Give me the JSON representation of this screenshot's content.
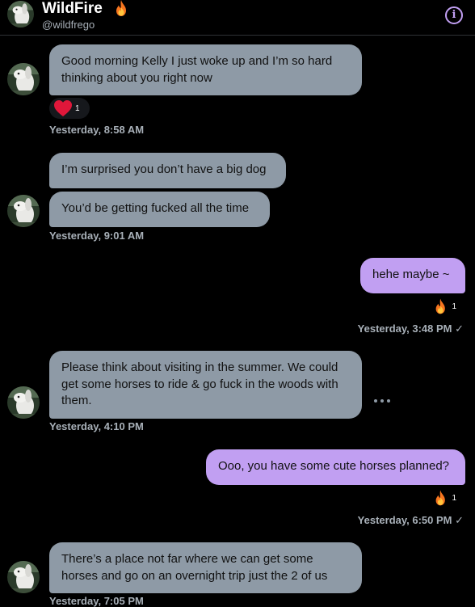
{
  "header": {
    "name": "WildFire",
    "handle": "@wildfrego",
    "info_symbol": "i"
  },
  "messages": [
    {
      "sender": "them",
      "text": "Good morning Kelly I just woke up and I’m so hard thinking about you right now",
      "reaction": {
        "emoji": "heart",
        "count": "1"
      },
      "timestamp": "Yesterday, 8:58 AM"
    },
    {
      "sender": "them",
      "text": "I’m surprised you don’t have a big dog"
    },
    {
      "sender": "them",
      "text": "You’d be getting fucked all the time",
      "timestamp": "Yesterday, 9:01 AM"
    },
    {
      "sender": "me",
      "text": "hehe maybe ~",
      "reaction": {
        "emoji": "fire",
        "count": "1"
      },
      "timestamp": "Yesterday, 3:48 PM ✓"
    },
    {
      "sender": "them",
      "text": "Please think about visiting in the summer. We could get some horses to ride & go fuck in the woods with them.",
      "timestamp": "Yesterday, 4:10 PM"
    },
    {
      "sender": "me",
      "text": "Ooo, you have some cute horses planned?",
      "reaction": {
        "emoji": "fire",
        "count": "1"
      },
      "timestamp": "Yesterday, 6:50 PM ✓"
    },
    {
      "sender": "them",
      "text": "There’s a place not far where we can get some horses and go on an overnight trip just the 2 of us",
      "timestamp": "Yesterday, 7:05 PM"
    }
  ],
  "colors": {
    "background": "#000000",
    "incoming_bubble": "#8e9aa6",
    "outgoing_bubble": "#c19ff2",
    "timestamp": "#a8b0b8",
    "accent": "#c19ff2"
  }
}
